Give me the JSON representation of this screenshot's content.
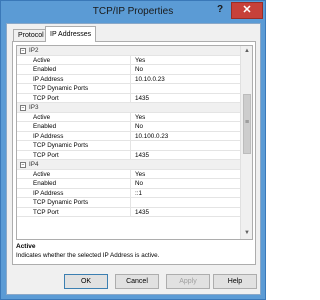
{
  "window": {
    "title": "TCP/IP Properties",
    "help_glyph": "?",
    "close_glyph": "✕"
  },
  "tabs": [
    {
      "label": "Protocol"
    },
    {
      "label": "IP Addresses"
    }
  ],
  "grid": {
    "sections": [
      {
        "name": "IP2",
        "rows": [
          {
            "key": "Active",
            "value": "Yes"
          },
          {
            "key": "Enabled",
            "value": "No"
          },
          {
            "key": "IP Address",
            "value": "10.10.0.23"
          },
          {
            "key": "TCP Dynamic Ports",
            "value": ""
          },
          {
            "key": "TCP Port",
            "value": "1435"
          }
        ]
      },
      {
        "name": "IP3",
        "rows": [
          {
            "key": "Active",
            "value": "Yes"
          },
          {
            "key": "Enabled",
            "value": "No"
          },
          {
            "key": "IP Address",
            "value": "10.100.0.23"
          },
          {
            "key": "TCP Dynamic Ports",
            "value": ""
          },
          {
            "key": "TCP Port",
            "value": "1435"
          }
        ]
      },
      {
        "name": "IP4",
        "rows": [
          {
            "key": "Active",
            "value": "Yes"
          },
          {
            "key": "Enabled",
            "value": "No"
          },
          {
            "key": "IP Address",
            "value": "::1"
          },
          {
            "key": "TCP Dynamic Ports",
            "value": ""
          },
          {
            "key": "TCP Port",
            "value": "1435"
          }
        ]
      }
    ],
    "scroll_thumb_glyph": "≡",
    "scroll_up_glyph": "▲",
    "scroll_down_glyph": "▼"
  },
  "description": {
    "title": "Active",
    "text": "Indicates whether the selected IP Address is active."
  },
  "buttons": {
    "ok": "OK",
    "cancel": "Cancel",
    "apply": "Apply",
    "help": "Help"
  },
  "colors": {
    "titlebar": "#5b9bd5",
    "close": "#c7413a",
    "annotation_arrow": "#e02020"
  }
}
